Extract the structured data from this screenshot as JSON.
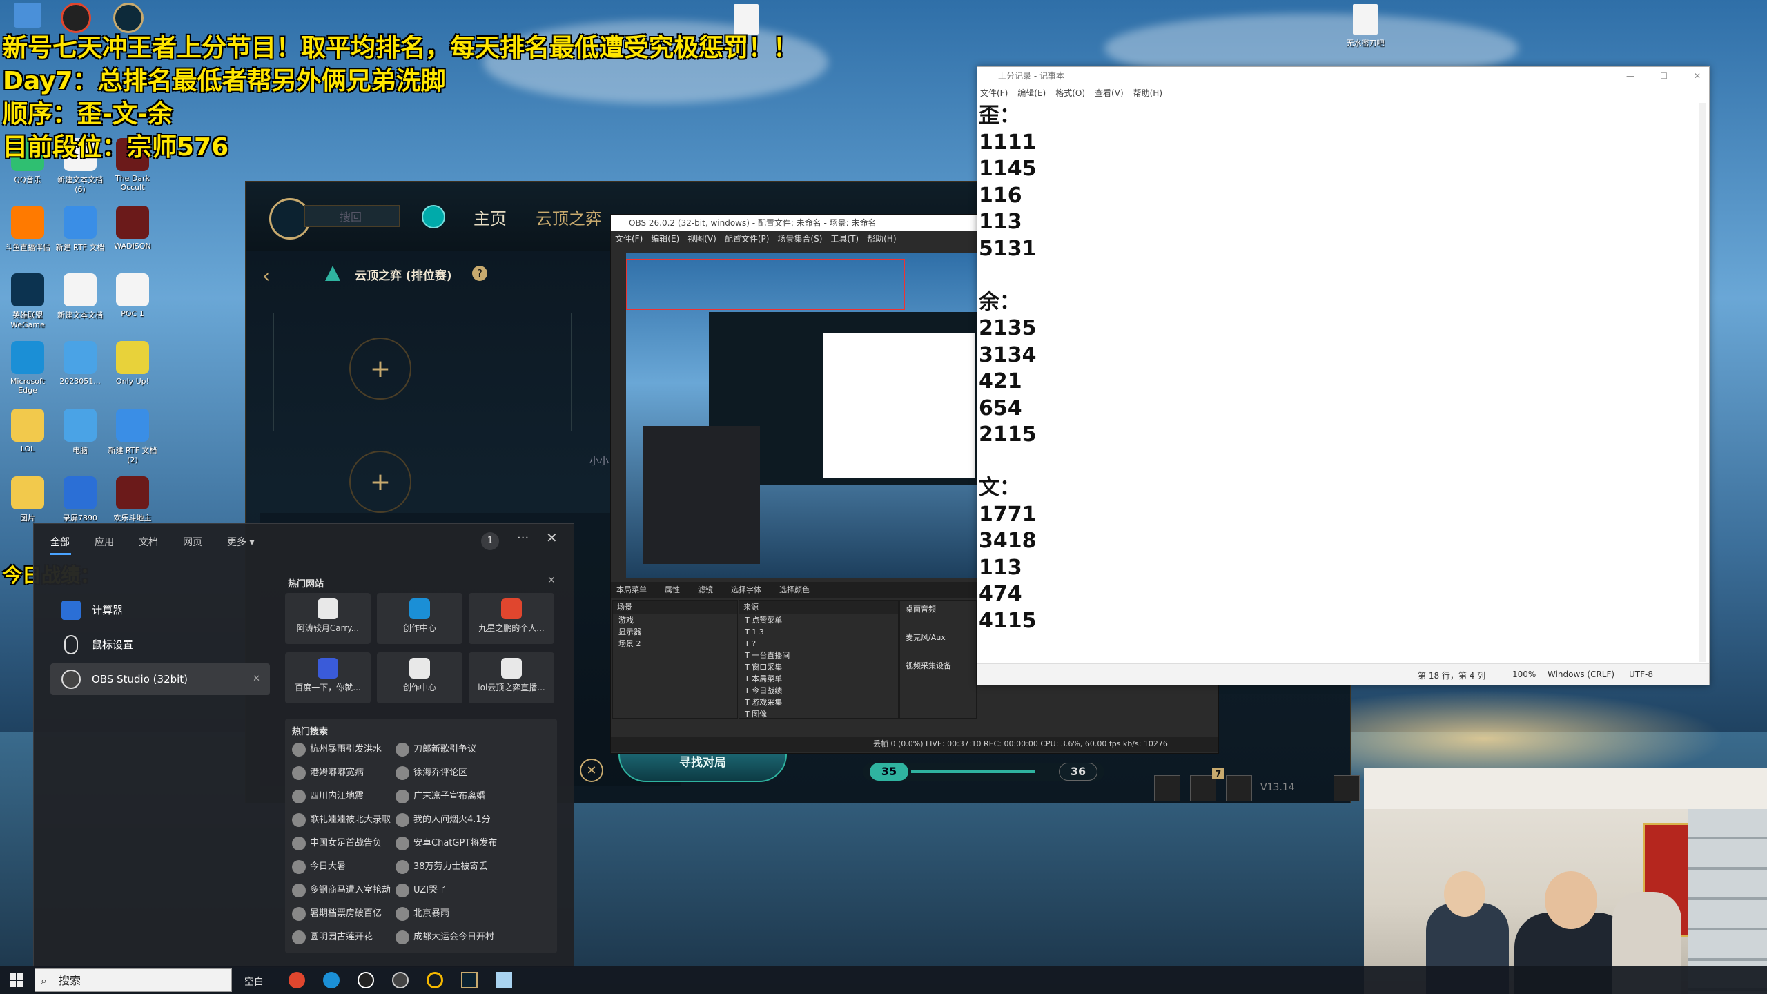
{
  "overlay": {
    "line1": "新号七天冲王者上分节目！取平均排名，每天排名最低遭受究极惩罚！！",
    "line2": "Day7：总排名最低者帮另外俩兄弟洗脚",
    "line3": "顺序：歪-文-余",
    "line4": "目前段位：宗师576",
    "today": "今日战绩："
  },
  "desktop_icons": [
    {
      "label": "QQ音乐",
      "icon": "qq-music-icon"
    },
    {
      "label": "新建文本文档 (6)",
      "icon": "text-file-icon"
    },
    {
      "label": "The Dark Occult",
      "icon": "game-icon"
    },
    {
      "label": "斗鱼直播伴侣",
      "icon": "douyu-icon"
    },
    {
      "label": "新建 RTF 文档",
      "icon": "rtf-file-icon"
    },
    {
      "label": "WADISON",
      "icon": "game-icon"
    },
    {
      "label": "英雄联盟WeGame",
      "icon": "wegame-icon"
    },
    {
      "label": "新建文本文档",
      "icon": "text-file-icon"
    },
    {
      "label": "POC 1",
      "icon": "text-file-icon"
    },
    {
      "label": "Microsoft Edge",
      "icon": "edge-icon"
    },
    {
      "label": "2023051...",
      "icon": "image-file-icon"
    },
    {
      "label": "Only Up!",
      "icon": "onlyup-icon"
    },
    {
      "label": "LOL",
      "icon": "folder-icon"
    },
    {
      "label": "电脑",
      "icon": "image-file-icon"
    },
    {
      "label": "新建 RTF 文档 (2)",
      "icon": "rtf-file-icon"
    },
    {
      "label": "图片",
      "icon": "folder-icon"
    },
    {
      "label": "录屏7890",
      "icon": "audio-icon"
    },
    {
      "label": "欢乐斗地主",
      "icon": "game-icon"
    }
  ],
  "top_files": [
    {
      "label": "",
      "icon": "text-file-icon"
    },
    {
      "label": "无水密刀吧",
      "icon": "text-file-icon"
    }
  ],
  "game": {
    "nav_home": "主页",
    "nav_tft": "云顶之弈",
    "mode": "云顶之弈 (排位赛)",
    "search_placeholder": "搜回",
    "side_label": "小小",
    "find_match": "寻找对局",
    "counter_left": "35",
    "counter_right": "36",
    "version": "V13.14",
    "badge": "7"
  },
  "notepad": {
    "title": "上分记录 - 记事本",
    "menu": [
      "文件(F)",
      "编辑(E)",
      "格式(O)",
      "查看(V)",
      "帮助(H)"
    ],
    "lines": [
      "歪：",
      "1111",
      "1145",
      "116",
      "113",
      "5131",
      "",
      "余：",
      "2135",
      "3134",
      "421",
      "654",
      "2115",
      "",
      "文：",
      "1771",
      "3418",
      "113",
      "474",
      "4115"
    ],
    "status_pos": "第 18 行，第 4 列",
    "status_zoom": "100%",
    "status_eol": "Windows (CRLF)",
    "status_enc": "UTF-8"
  },
  "obs": {
    "title": "OBS 26.0.2 (32-bit, windows) - 配置文件: 未命名 - 场景: 未命名",
    "menu": [
      "文件(F)",
      "编辑(E)",
      "视图(V)",
      "配置文件(P)",
      "场景集合(S)",
      "工具(T)",
      "帮助(H)"
    ],
    "toolbar": [
      "本局菜单",
      "属性",
      "滤镜",
      "选择字体",
      "选择颜色"
    ],
    "scenes_header": "场景",
    "sources_header": "来源",
    "scenes": [
      "游戏",
      "显示器",
      "场景 2"
    ],
    "sources": [
      "点赞菜单",
      "1 3",
      "?",
      "一台直播间",
      "窗口采集",
      "本局菜单",
      "今日战绩",
      "游戏采集",
      "图像"
    ],
    "mixer": [
      "桌面音频",
      "麦克风/Aux",
      "视频采集设备"
    ],
    "status": "丢帧 0 (0.0%)   LIVE: 00:37:10   REC: 00:00:00   CPU: 3.6%, 60.00 fps   kb/s: 10276"
  },
  "start_menu": {
    "tabs": [
      "全部",
      "应用",
      "文档",
      "网页",
      "更多"
    ],
    "count": "1",
    "results": [
      "计算器",
      "鼠标设置",
      "OBS Studio (32bit)"
    ],
    "hot_sites_title": "热门网站",
    "tiles": [
      "阿涛较月Carry...",
      "创作中心",
      "九星之鹏的个人...",
      "百度一下，你就...",
      "创作中心",
      "lol云顶之弈直播..."
    ],
    "hot_search_title": "热门搜索",
    "hot_searches": [
      [
        "杭州暴雨引发洪水",
        "刀郎新歌引争议"
      ],
      [
        "港姆嘟嘟宽病",
        "徐海乔评论区"
      ],
      [
        "四川内江地震",
        "广末凉子宣布离婚"
      ],
      [
        "歌礼娃娃被北大录取",
        "我的人间烟火4.1分"
      ],
      [
        "中国女足首战告负",
        "安卓ChatGPT将发布"
      ],
      [
        "今日大暑",
        "38万劳力士被寄丢"
      ],
      [
        "多钢商马遭入室抢劫",
        "UZI哭了"
      ],
      [
        "暑期档票房破百亿",
        "北京暴雨"
      ],
      [
        "圆明园古莲开花",
        "成都大运会今日开村"
      ]
    ]
  },
  "taskbar": {
    "search_placeholder": "搜索",
    "weather": "空白"
  }
}
